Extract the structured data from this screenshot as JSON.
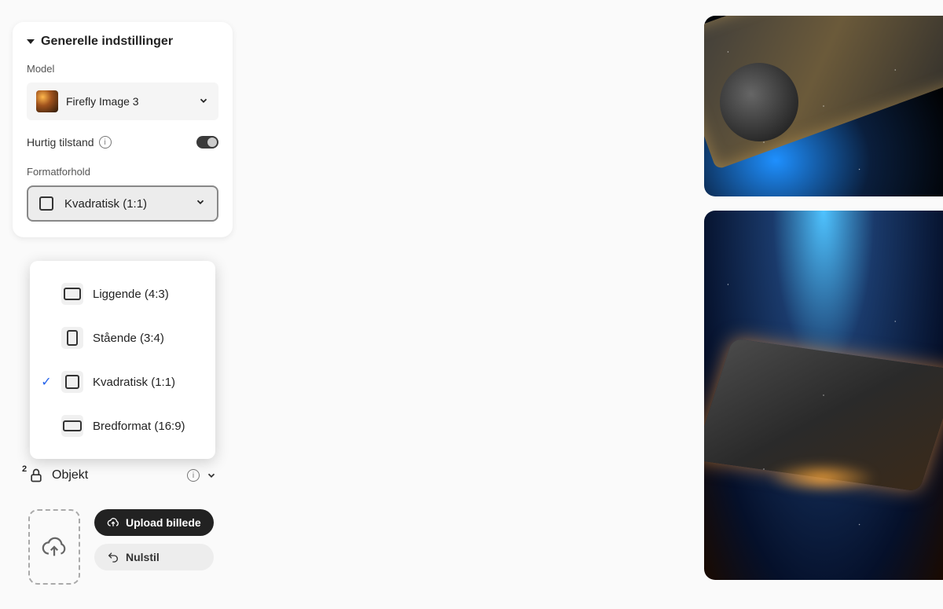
{
  "panel": {
    "section_title": "Generelle indstillinger",
    "model_label": "Model",
    "model_value": "Firefly Image 3",
    "fast_mode_label": "Hurtig tilstand",
    "aspect_label": "Formatforhold",
    "aspect_value": "Kvadratisk (1:1)",
    "aspect_options": [
      {
        "label": "Liggende (4:3)",
        "shape": "landscape",
        "selected": false
      },
      {
        "label": "Stående (3:4)",
        "shape": "portrait",
        "selected": false
      },
      {
        "label": "Kvadratisk (1:1)",
        "shape": "square",
        "selected": true
      },
      {
        "label": "Bredformat (16:9)",
        "shape": "wide",
        "selected": false
      }
    ],
    "object_header": "Objekt",
    "lock_badge": "2",
    "upload_button": "Upload billede",
    "reset_button": "Nulstil"
  }
}
